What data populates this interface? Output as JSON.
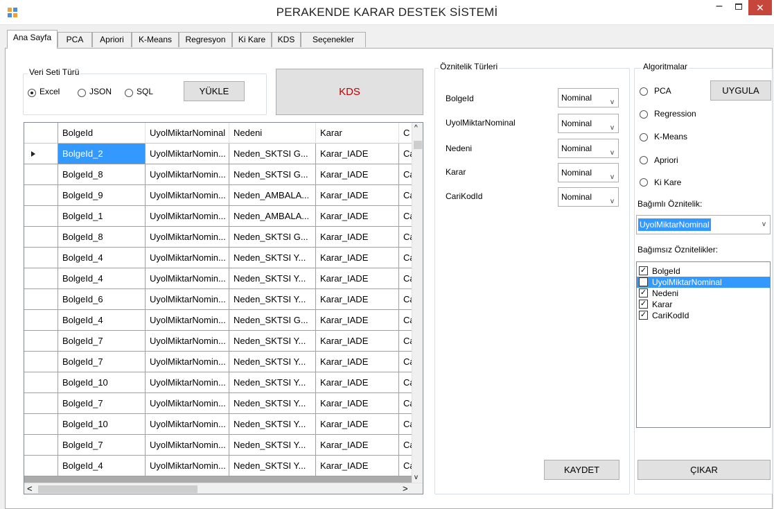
{
  "window": {
    "title": "PERAKENDE KARAR DESTEK SİSTEMİ",
    "minimize_glyph": "–",
    "close_glyph": "✕"
  },
  "tabs": [
    "Ana Sayfa",
    "PCA",
    "Apriori",
    "K-Means",
    "Regresyon",
    "Ki Kare",
    "KDS",
    "Seçenekler"
  ],
  "active_tab": "Ana Sayfa",
  "dataset": {
    "group_label": "Veri Seti Türü",
    "options": [
      "Excel",
      "JSON",
      "SQL"
    ],
    "selected": "Excel",
    "load_button": "YÜKLE"
  },
  "kds_button": "KDS",
  "grid": {
    "columns": [
      "BolgeId",
      "UyolMiktarNominal",
      "Nedeni",
      "Karar",
      "C"
    ],
    "rows": [
      [
        "BolgeId_2",
        "UyolMiktarNomin...",
        "Neden_SKTSI G...",
        "Karar_IADE",
        "Ca"
      ],
      [
        "BolgeId_8",
        "UyolMiktarNomin...",
        "Neden_SKTSI G...",
        "Karar_IADE",
        "Ca"
      ],
      [
        "BolgeId_9",
        "UyolMiktarNomin...",
        "Neden_AMBALA...",
        "Karar_IADE",
        "Ca"
      ],
      [
        "BolgeId_1",
        "UyolMiktarNomin...",
        "Neden_AMBALA...",
        "Karar_IADE",
        "Ca"
      ],
      [
        "BolgeId_8",
        "UyolMiktarNomin...",
        "Neden_SKTSI G...",
        "Karar_IADE",
        "Ca"
      ],
      [
        "BolgeId_4",
        "UyolMiktarNomin...",
        "Neden_SKTSI Y...",
        "Karar_IADE",
        "Ca"
      ],
      [
        "BolgeId_4",
        "UyolMiktarNomin...",
        "Neden_SKTSI Y...",
        "Karar_IADE",
        "Ca"
      ],
      [
        "BolgeId_6",
        "UyolMiktarNomin...",
        "Neden_SKTSI Y...",
        "Karar_IADE",
        "Ca"
      ],
      [
        "BolgeId_4",
        "UyolMiktarNomin...",
        "Neden_SKTSI G...",
        "Karar_IADE",
        "Ca"
      ],
      [
        "BolgeId_7",
        "UyolMiktarNomin...",
        "Neden_SKTSI Y...",
        "Karar_IADE",
        "Ca"
      ],
      [
        "BolgeId_7",
        "UyolMiktarNomin...",
        "Neden_SKTSI Y...",
        "Karar_IADE",
        "Ca"
      ],
      [
        "BolgeId_10",
        "UyolMiktarNomin...",
        "Neden_SKTSI Y...",
        "Karar_IADE",
        "Ca"
      ],
      [
        "BolgeId_7",
        "UyolMiktarNomin...",
        "Neden_SKTSI Y...",
        "Karar_IADE",
        "Ca"
      ],
      [
        "BolgeId_10",
        "UyolMiktarNomin...",
        "Neden_SKTSI Y...",
        "Karar_IADE",
        "Ca"
      ],
      [
        "BolgeId_7",
        "UyolMiktarNomin...",
        "Neden_SKTSI Y...",
        "Karar_IADE",
        "Ca"
      ],
      [
        "BolgeId_4",
        "UyolMiktarNomin...",
        "Neden_SKTSI Y...",
        "Karar_IADE",
        "Ca"
      ]
    ]
  },
  "attribute_types": {
    "group_label": "Öznitelik Türleri",
    "items": [
      {
        "name": "BolgeId",
        "type": "Nominal"
      },
      {
        "name": "UyolMiktarNominal",
        "type": "Nominal"
      },
      {
        "name": "Nedeni",
        "type": "Nominal"
      },
      {
        "name": "Karar",
        "type": "Nominal"
      },
      {
        "name": "CariKodId",
        "type": "Nominal"
      }
    ],
    "save_button": "KAYDET"
  },
  "algorithms": {
    "group_label": "Algoritmalar",
    "options": [
      "PCA",
      "Regression",
      "K-Means",
      "Apriori",
      "Ki Kare"
    ],
    "apply_button": "UYGULA",
    "dependent_label": "Bağımlı Öznitelik:",
    "dependent_value": "UyolMiktarNominal",
    "independent_label": "Bağımsız Öznitelikler:",
    "independent": [
      {
        "name": "BolgeId",
        "checked": true
      },
      {
        "name": "UyolMiktarNominal",
        "checked": false
      },
      {
        "name": "Nedeni",
        "checked": true
      },
      {
        "name": "Karar",
        "checked": true
      },
      {
        "name": "CariKodId",
        "checked": true
      }
    ],
    "exit_button": "ÇIKAR"
  },
  "icons": {
    "app": "app-window-icon",
    "combo_arrow": "chevron-down-icon",
    "row_pointer": "row-pointer-icon"
  },
  "colors": {
    "selection": "#3399ff",
    "kds_text": "#c00000",
    "close_button": "#c7463b"
  }
}
